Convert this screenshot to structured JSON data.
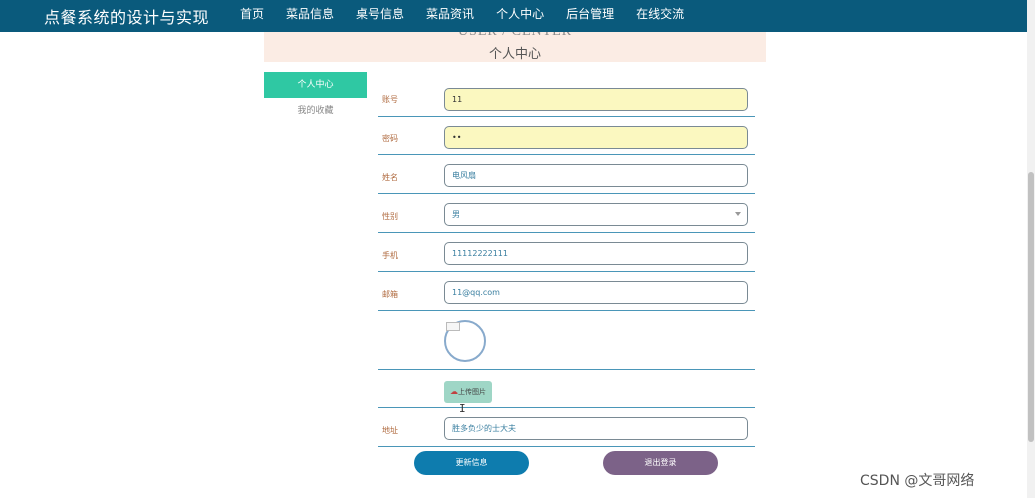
{
  "header": {
    "brand": "点餐系统的设计与实现",
    "nav": [
      "首页",
      "菜品信息",
      "桌号信息",
      "菜品资讯",
      "个人中心",
      "后台管理",
      "在线交流"
    ]
  },
  "banner": {
    "title_en": "USER / CENTER",
    "title_cn": "个人中心"
  },
  "sidebar": {
    "items": [
      "个人中心",
      "我的收藏"
    ],
    "active_index": 0
  },
  "form": {
    "account_label": "账号",
    "account_value": "11",
    "password_label": "密码",
    "password_value": "••",
    "name_label": "姓名",
    "name_value": "电风扇",
    "gender_label": "性别",
    "gender_value": "男",
    "phone_label": "手机",
    "phone_value": "11112222111",
    "email_label": "邮箱",
    "email_value": "11@qq.com",
    "upload_label": "上传图片",
    "address_label": "地址",
    "address_value": "胜多负少的士大夫"
  },
  "actions": {
    "update_label": "更新信息",
    "logout_label": "退出登录"
  },
  "watermark": "CSDN @文哥网络",
  "colors": {
    "topbar": "#0a5a7c",
    "active": "#2fc8a3",
    "update": "#0e7cae",
    "logout": "#7c6288"
  }
}
